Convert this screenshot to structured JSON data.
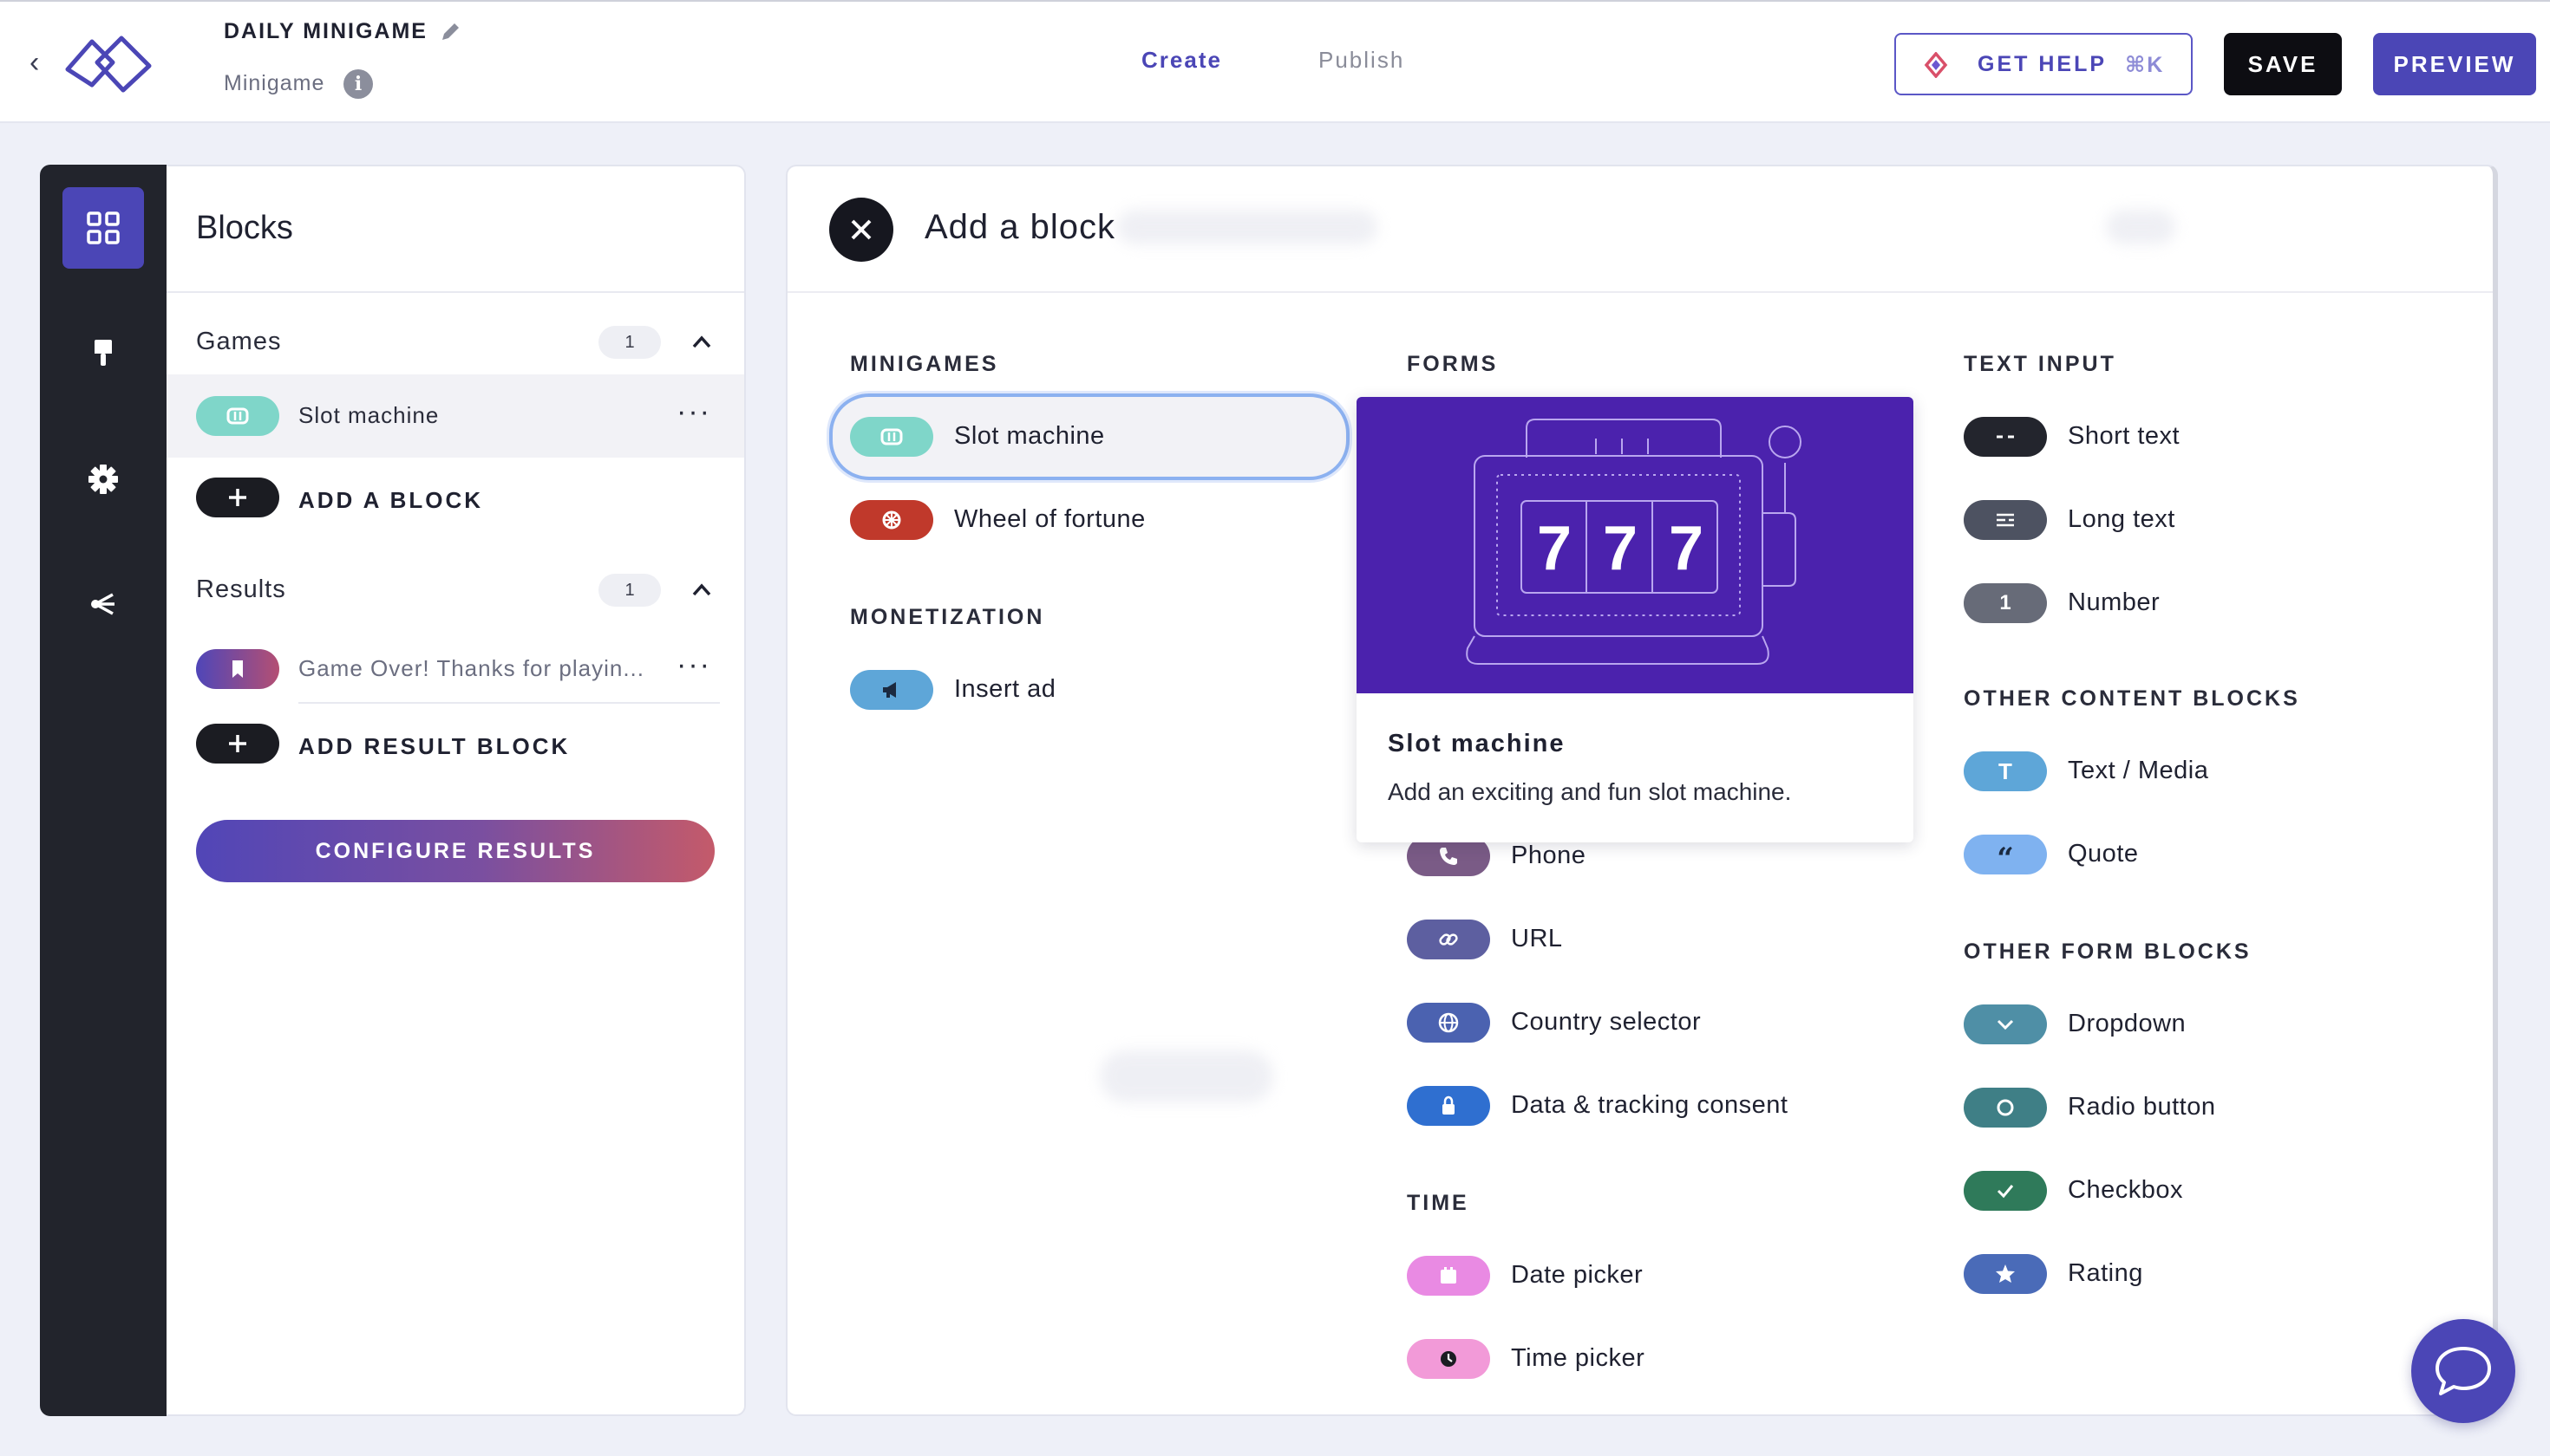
{
  "header": {
    "title": "DAILY MINIGAME",
    "subtitle": "Minigame",
    "tabs": [
      {
        "label": "Create",
        "active": true
      },
      {
        "label": "Publish",
        "active": false
      }
    ],
    "help": {
      "label": "GET HELP",
      "shortcut": "⌘K"
    },
    "save_label": "SAVE",
    "preview_label": "PREVIEW"
  },
  "rail": {
    "items": [
      {
        "icon": "grid-icon",
        "active": true
      },
      {
        "icon": "paint-brush-icon",
        "active": false
      },
      {
        "icon": "gear-icon",
        "active": false
      },
      {
        "icon": "share-flow-icon",
        "active": false
      }
    ]
  },
  "blocks_panel": {
    "title": "Blocks",
    "games": {
      "label": "Games",
      "count": "1",
      "items": [
        {
          "label": "Slot machine",
          "icon": "slot-machine-icon",
          "color": "#7fd6c9"
        }
      ],
      "add_label": "ADD A BLOCK"
    },
    "results": {
      "label": "Results",
      "count": "1",
      "items": [
        {
          "label": "Game Over! Thanks for playin...",
          "icon": "bookmark-icon"
        }
      ],
      "add_label": "ADD RESULT BLOCK"
    },
    "configure_label": "CONFIGURE RESULTS"
  },
  "add_panel": {
    "title": "Add a block",
    "minigames": {
      "heading": "MINIGAMES",
      "items": [
        {
          "label": "Slot machine",
          "icon": "slot-machine-icon",
          "color": "#7fd6c9"
        },
        {
          "label": "Wheel of fortune",
          "icon": "wheel-icon",
          "color": "#c0392b"
        }
      ]
    },
    "monetization": {
      "heading": "MONETIZATION",
      "items": [
        {
          "label": "Insert ad",
          "icon": "megaphone-icon",
          "color": "#5ea6d8"
        }
      ]
    },
    "forms": {
      "heading": "FORMS",
      "items": [
        {
          "label": "Phone",
          "icon": "phone-icon",
          "color": "#7a5b86"
        },
        {
          "label": "URL",
          "icon": "link-icon",
          "color": "#5d5fa0"
        },
        {
          "label": "Country selector",
          "icon": "globe-icon",
          "color": "#4b62b0"
        },
        {
          "label": "Data & tracking consent",
          "icon": "lock-icon",
          "color": "#2f6fd0"
        }
      ]
    },
    "time": {
      "heading": "TIME",
      "items": [
        {
          "label": "Date picker",
          "icon": "calendar-icon",
          "color": "#e98ae3"
        },
        {
          "label": "Time picker",
          "icon": "clock-icon",
          "color": "#f29ad8"
        }
      ]
    },
    "text_input": {
      "heading": "TEXT INPUT",
      "items": [
        {
          "label": "Short text",
          "icon": "short-text-icon",
          "color": "#23252d"
        },
        {
          "label": "Long text",
          "icon": "long-text-icon",
          "color": "#4d5261"
        },
        {
          "label": "Number",
          "icon": "number-icon",
          "color": "#676b78",
          "glyph": "1"
        }
      ]
    },
    "other_content": {
      "heading": "OTHER CONTENT BLOCKS",
      "items": [
        {
          "label": "Text / Media",
          "icon": "text-media-icon",
          "color": "#5ea6d8",
          "glyph": "T"
        },
        {
          "label": "Quote",
          "icon": "quote-icon",
          "color": "#7fb2f0",
          "glyph": "“"
        }
      ]
    },
    "other_form": {
      "heading": "OTHER FORM BLOCKS",
      "items": [
        {
          "label": "Dropdown",
          "icon": "chevron-down-icon",
          "color": "#4f8fa6"
        },
        {
          "label": "Radio button",
          "icon": "radio-icon",
          "color": "#3f7f86"
        },
        {
          "label": "Checkbox",
          "icon": "check-icon",
          "color": "#2f7a5a"
        },
        {
          "label": "Rating",
          "icon": "star-icon",
          "color": "#4a6bb8"
        }
      ]
    },
    "tooltip": {
      "title": "Slot machine",
      "description": "Add an exciting and fun slot machine.",
      "reels": [
        "7",
        "7",
        "7"
      ]
    }
  }
}
